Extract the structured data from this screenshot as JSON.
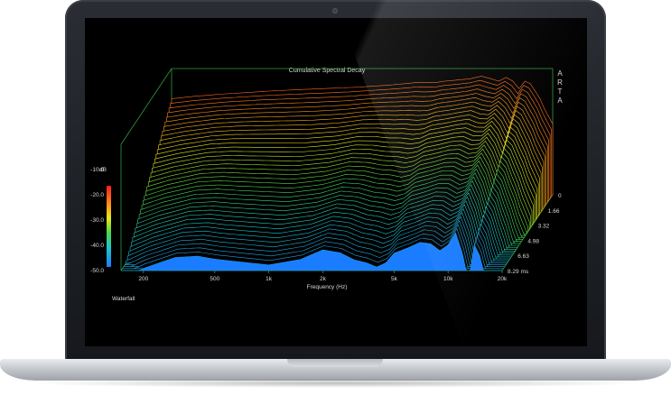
{
  "chart_data": {
    "type": "waterfall",
    "title": "Cumulative Spectral Decay",
    "brand": "ARTA",
    "caption": "Waterfall",
    "xlabel": "Frequency (Hz)",
    "x_scale": "log",
    "x_ticks": [
      "200",
      "500",
      "1k",
      "2k",
      "5k",
      "10k",
      "20k"
    ],
    "x_tick_values": [
      200,
      500,
      1000,
      2000,
      5000,
      10000,
      20000
    ],
    "xlim": [
      150,
      20000
    ],
    "ylabel": "dB",
    "y_ticks": [
      "-10.0",
      "-20.0",
      "-30.0",
      "-40.0",
      "-50.0"
    ],
    "y_tick_values": [
      -10,
      -20,
      -30,
      -40,
      -50
    ],
    "ylim": [
      -50,
      0
    ],
    "z_ticks": [
      "0",
      "1.66",
      "3.32",
      "4.98",
      "6.63",
      "8.29 ms"
    ],
    "z_tick_values": [
      0,
      1.66,
      3.32,
      4.98,
      6.63,
      8.29
    ],
    "zlim": [
      0,
      8.29
    ],
    "grid": false,
    "colors": {
      "background": "#000000",
      "frame": "#2f9c3a",
      "text": "#d8d8d8",
      "floor": "#1a7cff"
    },
    "profile_frequencies": [
      150,
      200,
      300,
      400,
      500,
      700,
      1000,
      1500,
      2000,
      2500,
      3000,
      3500,
      4000,
      4500,
      5000,
      6000,
      7000,
      8000,
      9000,
      10000,
      11000,
      12000,
      13000,
      14000,
      15000,
      16000,
      17000,
      18000,
      20000
    ],
    "initial_response_db": [
      -12,
      -11,
      -10,
      -9.5,
      -9,
      -8.5,
      -8,
      -7.5,
      -7,
      -6.5,
      -6,
      -5.5,
      -5.5,
      -5.5,
      -5,
      -4.5,
      -4,
      -3,
      -4,
      -5,
      -3.5,
      -5,
      -8,
      -5,
      -6,
      -9,
      -12,
      -16,
      -22
    ],
    "decay_rate_db_per_ms": [
      5,
      4.6,
      4.2,
      4.2,
      4.4,
      4.6,
      4.8,
      4.6,
      4.2,
      4.4,
      4.8,
      5,
      5.2,
      5,
      4.6,
      4.4,
      4.2,
      4.4,
      4.6,
      4.2,
      3.8,
      4.6,
      5.6,
      4.2,
      4.6,
      5.2,
      5.6,
      6,
      6.5
    ],
    "slice_count": 40
  }
}
